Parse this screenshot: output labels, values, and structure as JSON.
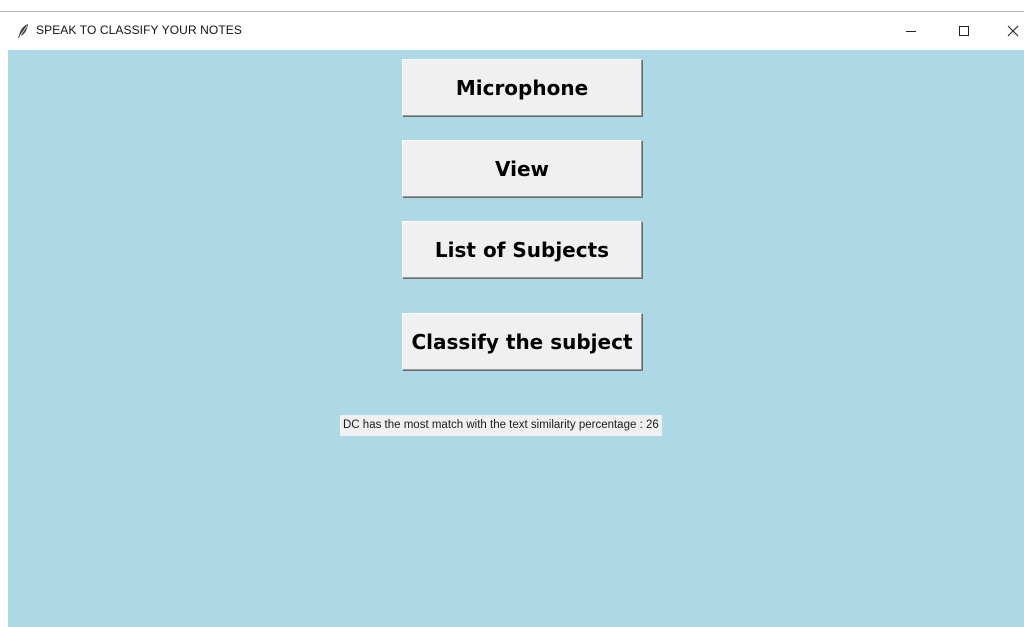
{
  "window": {
    "title": "SPEAK TO CLASSIFY YOUR NOTES",
    "app_icon": "feather-icon",
    "controls": {
      "minimize_icon": "minimize-icon",
      "maximize_icon": "maximize-icon",
      "close_icon": "close-icon"
    }
  },
  "buttons": {
    "microphone": "Microphone",
    "view": "View",
    "list_of_subjects": "List of Subjects",
    "classify": "Classify the subject"
  },
  "result": {
    "text": "DC has the most match with the text similarity percentage : 26"
  },
  "colors": {
    "background": "#add8e6",
    "button_face": "#f0f0f0",
    "titlebar": "#ffffff"
  }
}
